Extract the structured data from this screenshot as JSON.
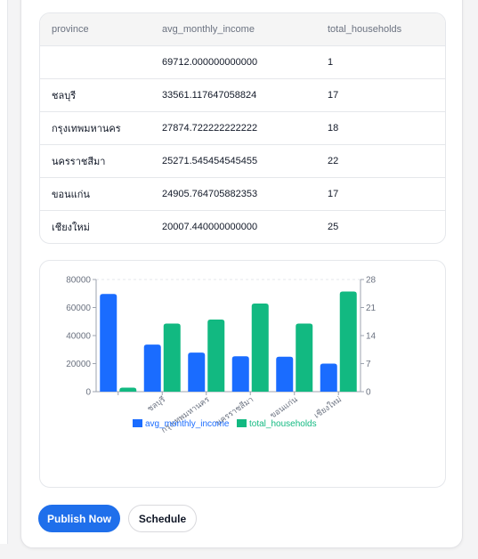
{
  "table": {
    "columns": [
      "province",
      "avg_monthly_income",
      "total_households"
    ],
    "rows": [
      [
        "",
        "69712.000000000000",
        "1"
      ],
      [
        "ชลบุรี",
        "33561.117647058824",
        "17"
      ],
      [
        "กรุงเทพมหานคร",
        "27874.722222222222",
        "18"
      ],
      [
        "นครราชสีมา",
        "25271.545454545455",
        "22"
      ],
      [
        "ขอนแก่น",
        "24905.764705882353",
        "17"
      ],
      [
        "เชียงใหม่",
        "20007.440000000000",
        "25"
      ]
    ]
  },
  "chart_data": {
    "type": "bar",
    "categories": [
      "",
      "ชลบุรี",
      "กรุงเทพมหานคร",
      "นครราชสีมา",
      "ขอนแก่น",
      "เชียงใหม่"
    ],
    "series": [
      {
        "name": "avg_monthly_income",
        "axis": "left",
        "color": "#1a6cff",
        "values": [
          69712.0,
          33561.12,
          27874.72,
          25271.55,
          24905.76,
          20007.44
        ]
      },
      {
        "name": "total_households",
        "axis": "right",
        "color": "#12b981",
        "values": [
          1,
          17,
          18,
          22,
          17,
          25
        ]
      }
    ],
    "yleft": {
      "ticks": [
        "0",
        "20000",
        "40000",
        "60000",
        "80000"
      ],
      "lim": [
        0,
        80000
      ]
    },
    "yright": {
      "ticks": [
        "0",
        "7",
        "14",
        "21",
        "28"
      ],
      "lim": [
        0,
        28
      ]
    },
    "legend_position": "bottom",
    "grid": false
  },
  "actions": {
    "publish_label": "Publish Now",
    "schedule_label": "Schedule"
  }
}
